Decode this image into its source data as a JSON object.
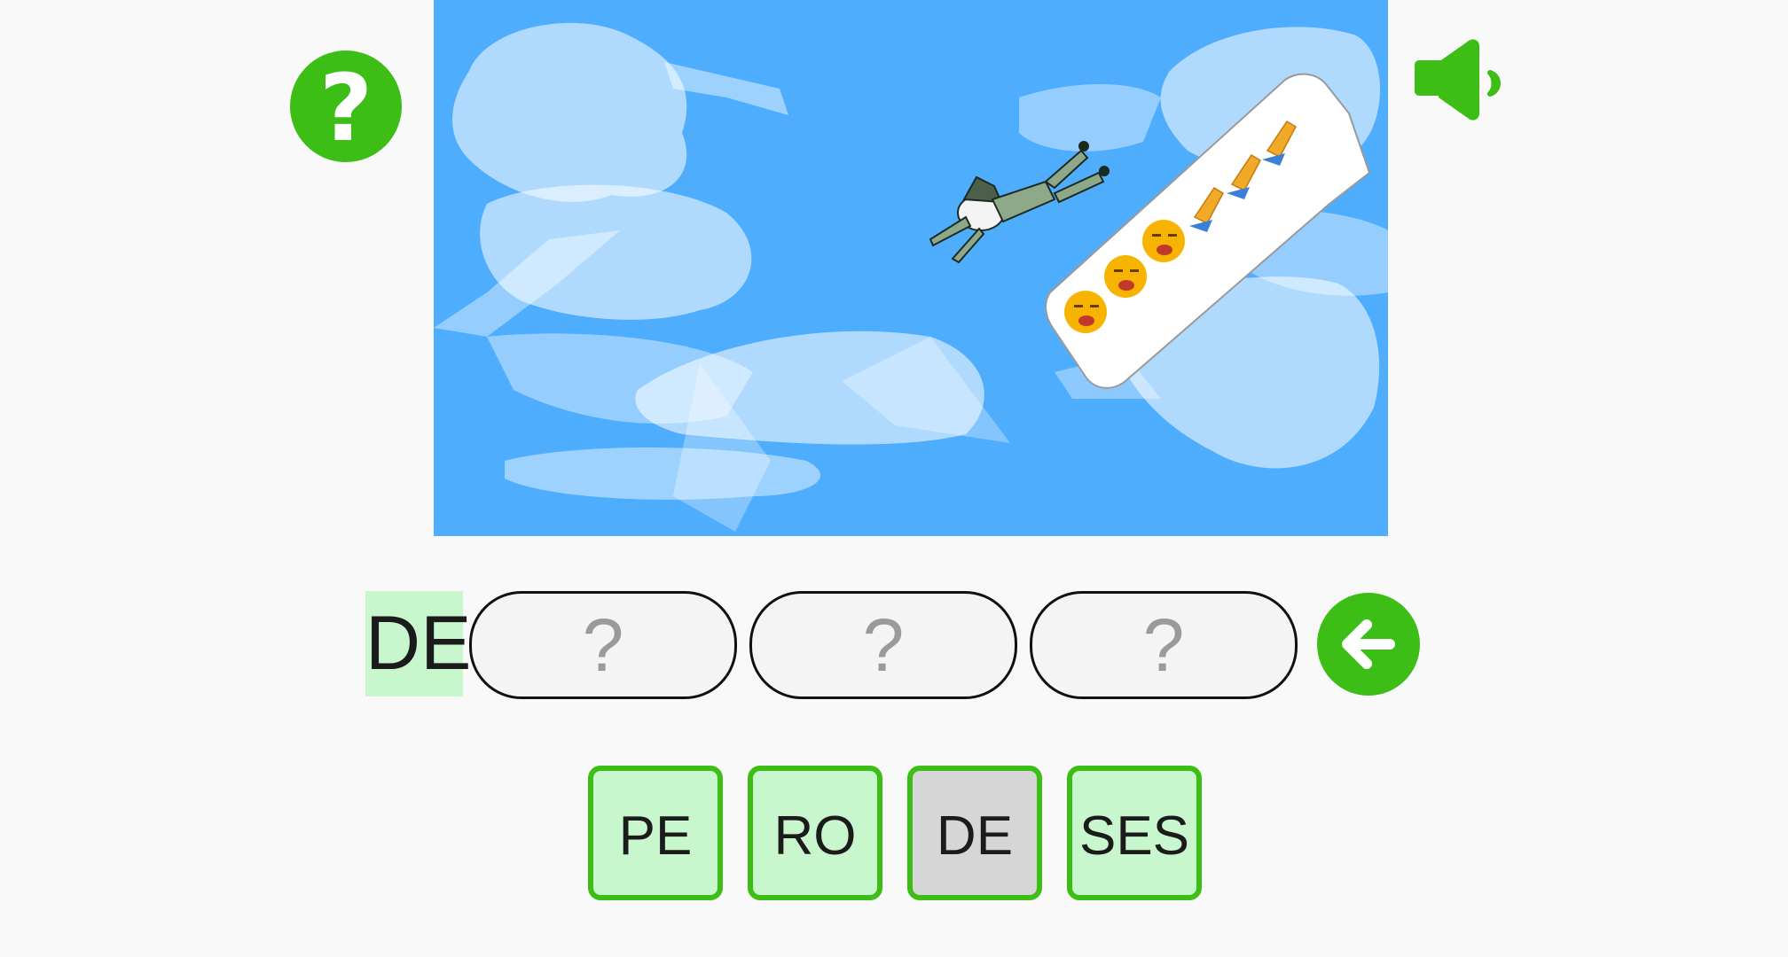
{
  "game": {
    "help_symbol": "?",
    "answer_prefix": "DE",
    "slots": [
      {
        "placeholder": "?"
      },
      {
        "placeholder": "?"
      },
      {
        "placeholder": "?"
      }
    ],
    "tiles": [
      {
        "label": "PE",
        "used": false
      },
      {
        "label": "RO",
        "used": false
      },
      {
        "label": "DE",
        "used": true
      },
      {
        "label": "SES",
        "used": false
      }
    ]
  },
  "picture": {
    "sky_color": "#4fadfd",
    "speech_bubble_emojis": [
      "tired-face",
      "tired-face",
      "tired-face",
      "folded-hands",
      "folded-hands",
      "folded-hands"
    ]
  },
  "icons": {
    "help": "question-mark-icon",
    "sound": "speaker-icon",
    "back": "arrow-left-icon"
  },
  "colors": {
    "accent_green": "#3cbe16",
    "tile_fill": "#c8f7cd",
    "tile_used_fill": "#d6d6d6",
    "page_background": "#f9f9f9"
  }
}
